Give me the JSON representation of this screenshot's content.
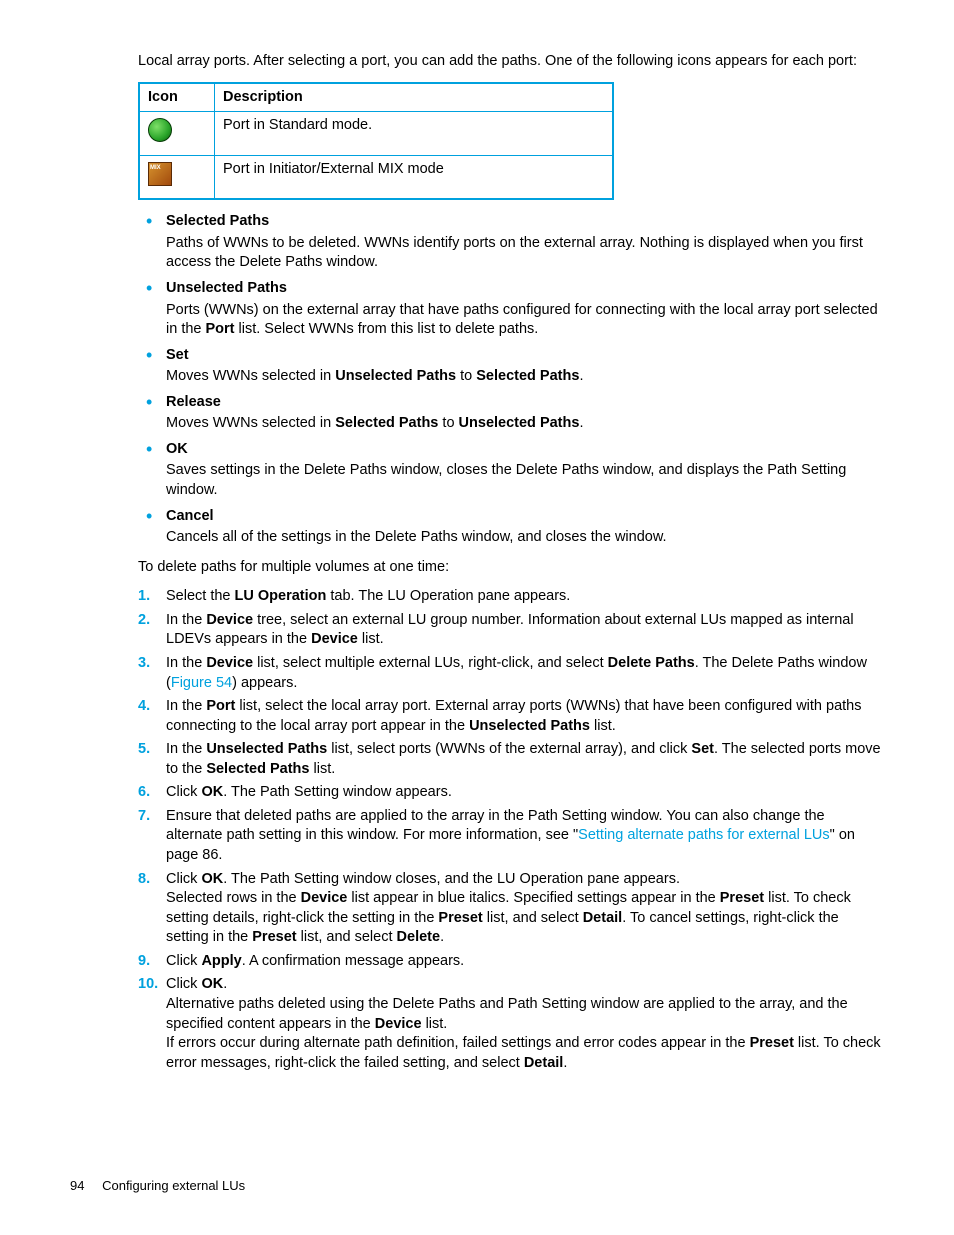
{
  "intro": "Local array ports. After selecting a port, you can add the paths. One of the following icons appears for each port:",
  "table": {
    "headers": [
      "Icon",
      "Description"
    ],
    "rows": [
      {
        "icon": "port-standard-icon",
        "desc": "Port in Standard mode."
      },
      {
        "icon": "port-mix-icon",
        "desc": "Port in Initiator/External MIX mode"
      }
    ]
  },
  "bullets": [
    {
      "head": "Selected Paths",
      "desc_html": "Paths of WWNs to be deleted. WWNs identify ports on the external array. Nothing is displayed when you first access the Delete Paths window."
    },
    {
      "head": "Unselected Paths",
      "desc_html": "Ports (WWNs) on the external array that have paths configured for connecting with the local array port selected in the <b>Port</b> list. Select WWNs from this list to delete paths."
    },
    {
      "head": "Set",
      "desc_html": "Moves WWNs selected in <b>Unselected Paths</b> to <b>Selected Paths</b>."
    },
    {
      "head": "Release",
      "desc_html": "Moves WWNs selected in <b>Selected Paths</b> to <b>Unselected Paths</b>."
    },
    {
      "head": "OK",
      "desc_html": "Saves settings in the Delete Paths window, closes the Delete Paths window, and displays the Path Setting window."
    },
    {
      "head": "Cancel",
      "desc_html": "Cancels all of the settings in the Delete Paths window, and closes the window."
    }
  ],
  "lead2": "To delete paths for multiple volumes at one time:",
  "steps": [
    "Select the <b>LU Operation</b> tab. The LU Operation pane appears.",
    "In the <b>Device</b> tree, select an external LU group number. Information about external LUs mapped as internal LDEVs appears in the <b>Device</b> list.",
    "In the <b>Device</b> list, select multiple external LUs, right-click, and select <b>Delete Paths</b>. The Delete Paths window (<span class=\"link\">Figure 54</span>) appears.",
    "In the <b>Port</b> list, select the local array port. External array ports (WWNs) that have been configured with paths connecting to the local array port appear in the <b>Unselected Paths</b> list.",
    "In the <b>Unselected Paths</b> list, select ports (WWNs of the external array), and click <b>Set</b>. The selected ports move to the <b>Selected Paths</b> list.",
    "Click <b>OK</b>. The Path Setting window appears.",
    "Ensure that deleted paths are applied to the array in the Path Setting window. You can also change the alternate path setting in this window. For more information, see \"<span class=\"link\">Setting alternate paths for external LUs</span>\" on page 86.",
    "Click <b>OK</b>. The Path Setting window closes, and the LU Operation pane appears.<br>Selected rows in the <b>Device</b> list appear in blue italics. Specified settings appear in the <b>Preset</b> list. To check setting details, right-click the setting in the <b>Preset</b> list, and select <b>Detail</b>. To cancel settings, right-click the setting in the <b>Preset</b> list, and select <b>Delete</b>.",
    "Click <b>Apply</b>. A confirmation message appears.",
    "Click <b>OK</b>.<br>Alternative paths deleted using the Delete Paths and Path Setting window are applied to the array, and the specified content appears in the <b>Device</b> list.<br>If errors occur during alternate path definition, failed settings and error codes appear in the <b>Preset</b> list. To check error messages, right-click the failed setting, and select <b>Detail</b>."
  ],
  "footer": {
    "page": "94",
    "title": "Configuring external LUs"
  }
}
